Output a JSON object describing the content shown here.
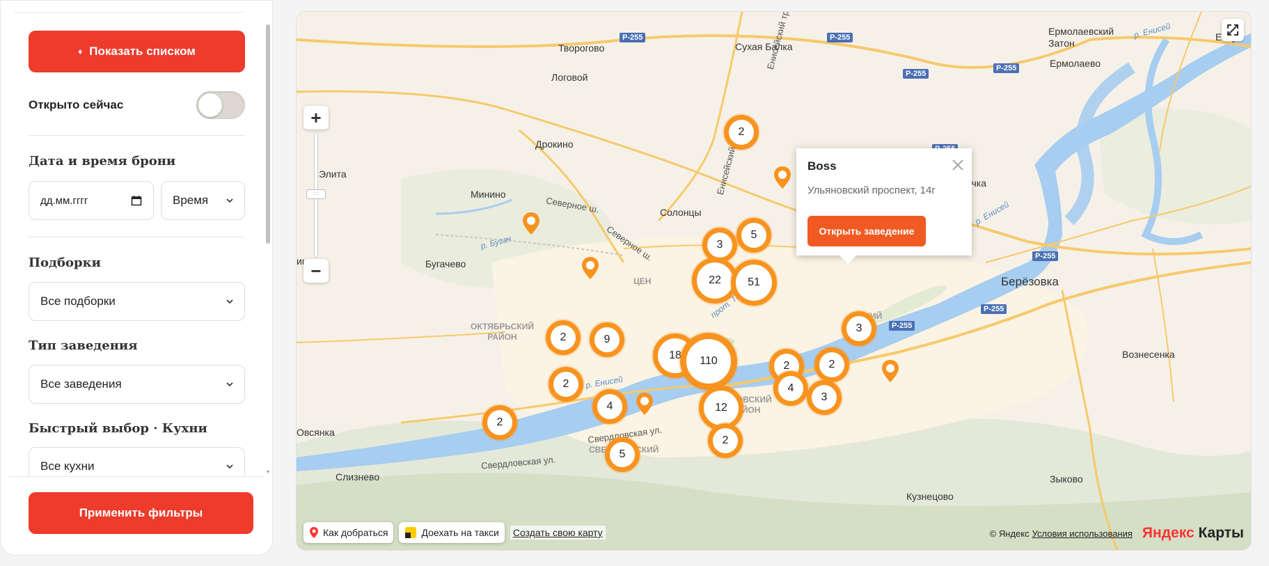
{
  "sidebar": {
    "show_list_label": "Показать списком",
    "open_now_label": "Открыто сейчас",
    "open_now_on": false,
    "booking": {
      "title": "Дата и время брони",
      "date_placeholder": "дд.мм.гггг",
      "time_label": "Время"
    },
    "collections": {
      "title": "Подборки",
      "value": "Все подборки"
    },
    "venue_type": {
      "title": "Тип заведения",
      "value": "Все заведения"
    },
    "cuisine": {
      "title": "Быстрый выбор · Кухни",
      "value": "Все кухни"
    },
    "apply_label": "Применить фильтры"
  },
  "map": {
    "places": {
      "tvorogovo": "Творогово",
      "sukhaya_balka": "Сухая Балка",
      "logovoy": "Логовой",
      "ermolaevsky_zaton": "Ермолаевский\nЗатон",
      "esaul": "Есау",
      "ermolaevo": "Ермолаево",
      "drokino": "Дрокино",
      "elita": "Элита",
      "minino": "Минино",
      "solontsy": "Солонцы",
      "bugachevo": "Бугачево",
      "beryozovka": "Берёзовка",
      "voznesenka": "Вознесенка",
      "ovsyanka": "Овсянка",
      "sliznevo": "Слизнево",
      "kuznetsovo": "Кузнецово",
      "zykovo": "Зыково",
      "kachka": "ачка",
      "k": "К",
      "tsen": "ЦЕН",
      "inino": "инино"
    },
    "roads": {
      "severnoe1": "Северное ш.",
      "severnoe2": "Северное ш.",
      "sverdlovskaya1": "Свердловская ул.",
      "sverdlovskaya2": "Свердловская ул.",
      "eniseysky": "Енисейский тракт",
      "eniseysky2": "Енисейский тракт"
    },
    "rivers": {
      "bugach": "р. Бугач",
      "yenisei1": "р. Енисей",
      "yenisei2": "р. Енисей",
      "tatysheva": "прот. Татышева",
      "yenisei3": "р. Енисей"
    },
    "districts": {
      "oktyabrsky": "ОКТЯБРЬСКИЙ\nРАЙОН",
      "sverdlovsky": "СВЕРДЛОВСКИЙ\nРАЙОН",
      "kirovsky": "КИРОВСКИЙ\nРАЙОН",
      "leninsky": "СКИЙ\nН"
    },
    "road_codes": [
      "Р-255",
      "Р-255",
      "Р-255",
      "Р-255",
      "Р-255",
      "Р-255",
      "Р-255",
      "Р-255"
    ],
    "clusters": [
      "2",
      "3",
      "5",
      "22",
      "51",
      "2",
      "9",
      "18",
      "110",
      "2",
      "2",
      "3",
      "4",
      "12",
      "3",
      "2",
      "4",
      "2",
      "2"
    ],
    "popup": {
      "title": "Boss",
      "address": "Ульяновский проспект, 14г",
      "button_label": "Открыть заведение"
    },
    "bottom": {
      "route_label": "Как добраться",
      "taxi_label": "Доехать на такси",
      "create_map_label": "Создать свою карту",
      "copyright": "© Яндекс",
      "terms": "Условия использования",
      "logo_part1": "Яндекс",
      "logo_part2": "Карты"
    }
  }
}
